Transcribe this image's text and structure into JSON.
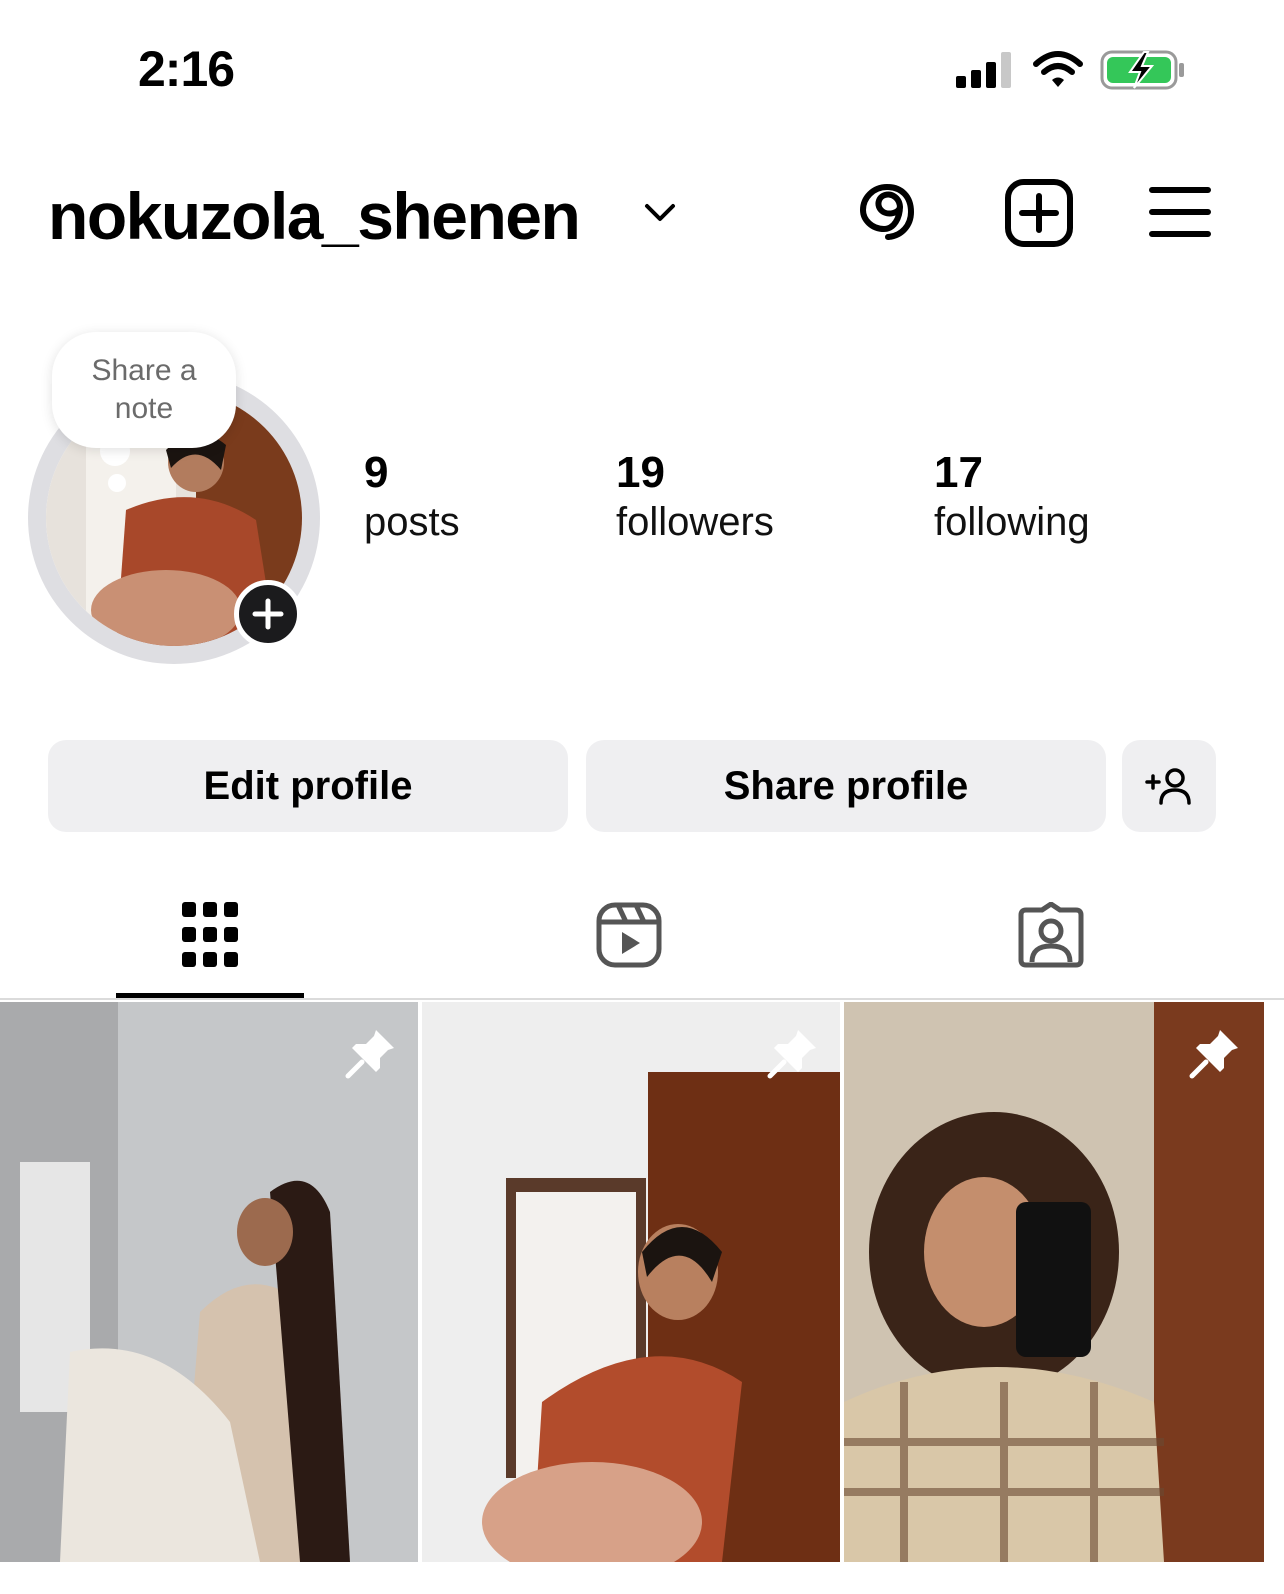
{
  "status_bar": {
    "time": "2:16",
    "icons": [
      "signal-icon",
      "wifi-icon",
      "battery-charging-icon"
    ],
    "battery_color": "#34c759"
  },
  "header": {
    "username": "nokuzola_shenen",
    "icons": [
      "chevron-down-icon",
      "threads-icon",
      "create-post-icon",
      "menu-icon"
    ]
  },
  "note": {
    "text_line1": "Share a",
    "text_line2": "note"
  },
  "stats": [
    {
      "count": "9",
      "label": "posts"
    },
    {
      "count": "19",
      "label": "followers"
    },
    {
      "count": "17",
      "label": "following"
    }
  ],
  "actions": {
    "edit_label": "Edit profile",
    "share_label": "Share profile",
    "discover_icon": "add-person-icon"
  },
  "tabs": [
    {
      "icon": "grid-icon",
      "active": true
    },
    {
      "icon": "reels-icon",
      "active": false
    },
    {
      "icon": "tagged-icon",
      "active": false
    }
  ],
  "posts": [
    {
      "pinned": true
    },
    {
      "pinned": true
    },
    {
      "pinned": true
    }
  ]
}
